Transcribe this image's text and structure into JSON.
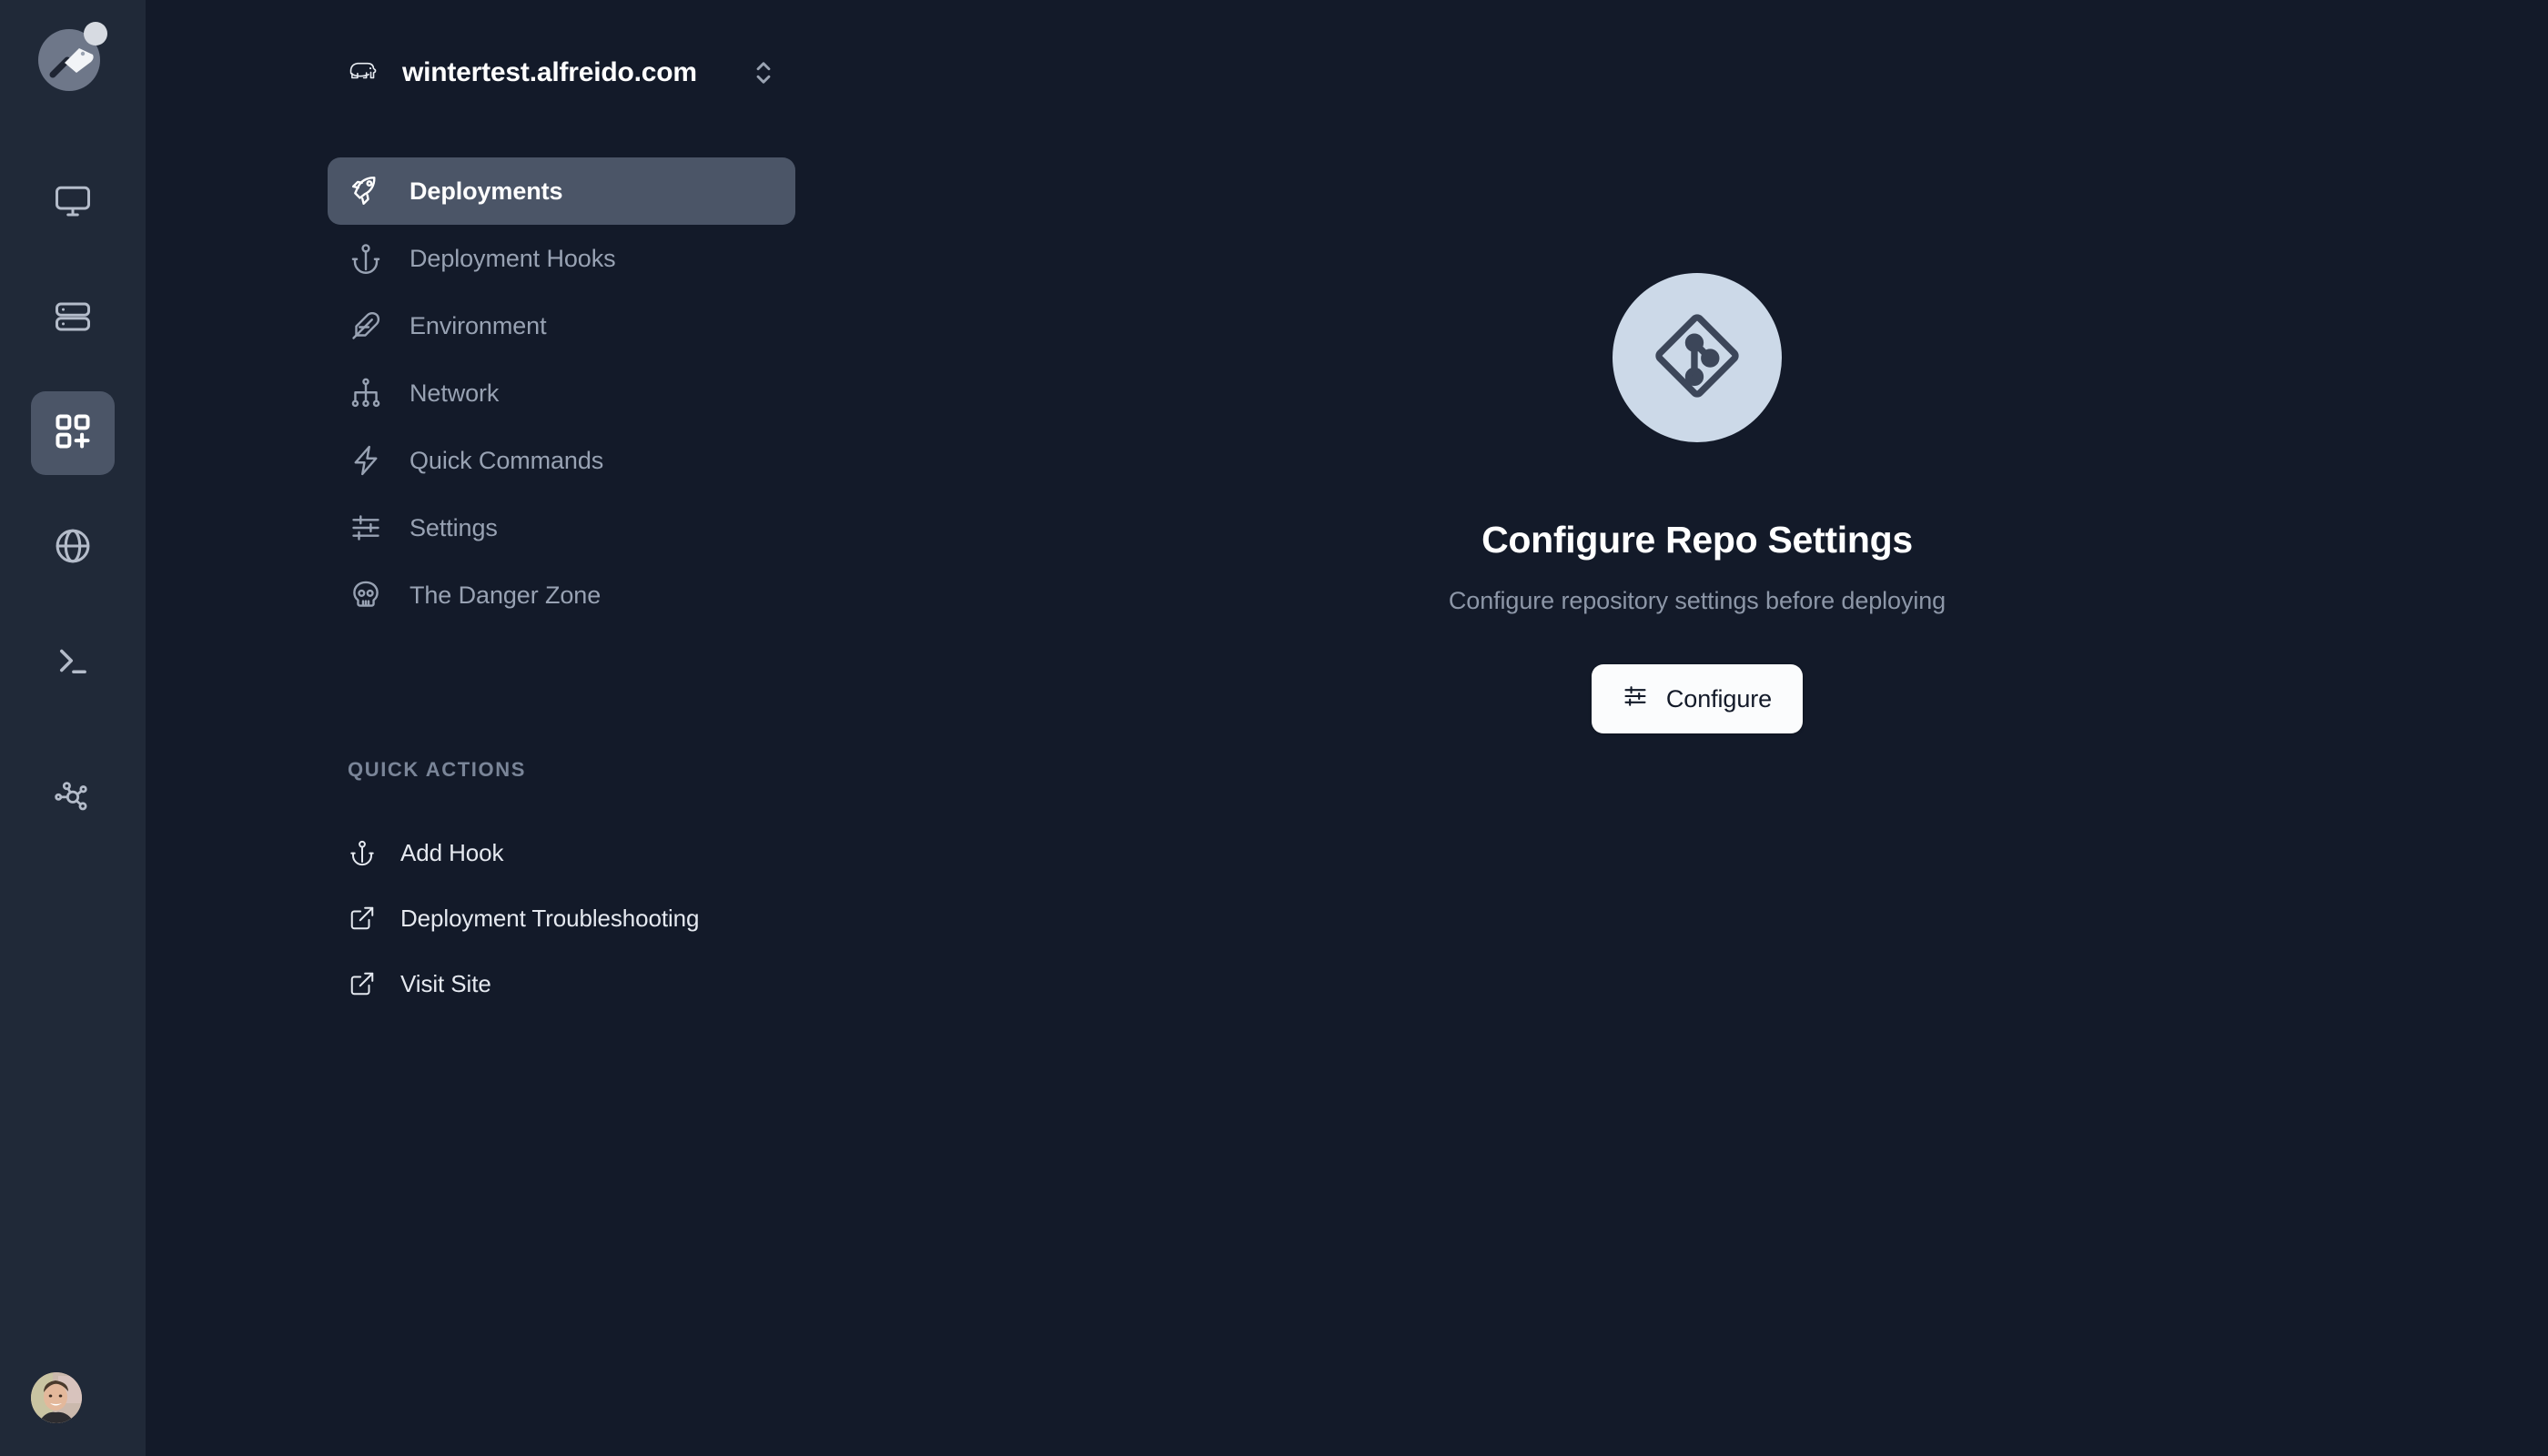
{
  "theme": {
    "rail_bg": "#202938",
    "panel_bg": "#131a29",
    "active_item_bg": "#4b5567",
    "muted_text": "#98a2b3",
    "bright_text": "#ffffff",
    "git_badge_bg": "#ccd9e8",
    "button_bg": "#fbfcfd"
  },
  "rail": {
    "logo_name": "cleaver-logo",
    "items": [
      {
        "icon": "monitor-icon",
        "active": false
      },
      {
        "icon": "server-icon",
        "active": false
      },
      {
        "icon": "grid-plus-icon",
        "active": true
      },
      {
        "icon": "globe-icon",
        "active": false
      },
      {
        "icon": "terminal-icon",
        "active": false
      },
      {
        "icon": "network-nodes-icon",
        "active": false
      }
    ],
    "avatar_name": "user-avatar"
  },
  "project": {
    "icon": "elephant-icon",
    "name": "wintertest.alfreido.com",
    "selector_icon": "chevron-up-down-icon"
  },
  "nav": {
    "items": [
      {
        "label": "Deployments",
        "icon": "rocket-icon",
        "active": true
      },
      {
        "label": "Deployment Hooks",
        "icon": "anchor-icon",
        "active": false
      },
      {
        "label": "Environment",
        "icon": "feather-icon",
        "active": false
      },
      {
        "label": "Network",
        "icon": "hierarchy-icon",
        "active": false
      },
      {
        "label": "Quick Commands",
        "icon": "bolt-icon",
        "active": false
      },
      {
        "label": "Settings",
        "icon": "sliders-icon",
        "active": false
      },
      {
        "label": "The Danger Zone",
        "icon": "skull-icon",
        "active": false
      }
    ]
  },
  "quick_actions": {
    "heading": "QUICK ACTIONS",
    "items": [
      {
        "label": "Add Hook",
        "icon": "anchor-icon"
      },
      {
        "label": "Deployment Troubleshooting",
        "icon": "external-link-icon"
      },
      {
        "label": "Visit Site",
        "icon": "external-link-icon"
      }
    ]
  },
  "main": {
    "badge_icon": "git-icon",
    "title": "Configure Repo Settings",
    "subtitle": "Configure repository settings before deploying",
    "button_label": "Configure",
    "button_icon": "sliders-icon"
  }
}
